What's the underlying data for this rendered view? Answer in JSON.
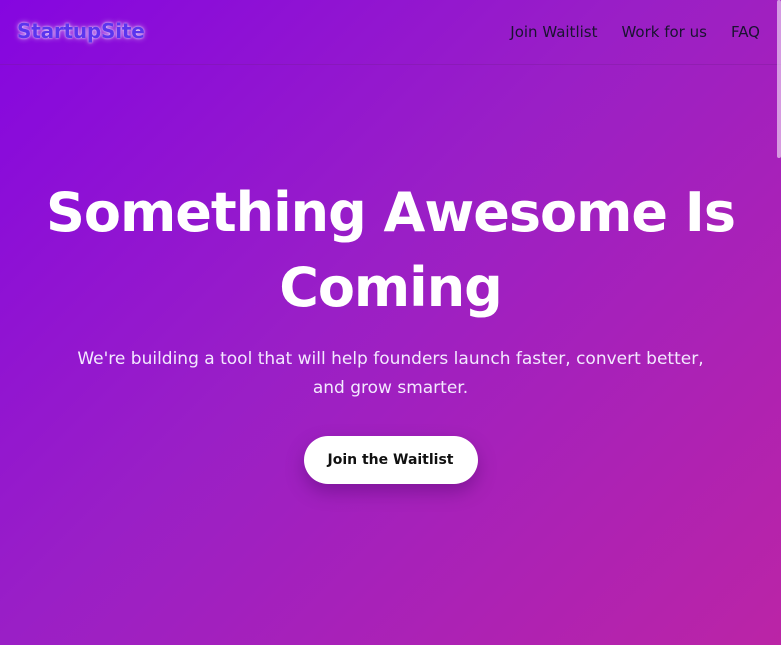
{
  "header": {
    "brand": "StartupSite",
    "nav": [
      "Join Waitlist",
      "Work for us",
      "FAQ"
    ]
  },
  "hero": {
    "title": "Something Awesome Is Coming",
    "subtitle": "We're building a tool that will help founders launch faster, convert better, and grow smarter.",
    "cta_label": "Join the Waitlist"
  },
  "colors": {
    "background_start": "#8506e0",
    "background_end": "#bb24a6",
    "brand": "#5a35ee",
    "nav_text": "#1a1330",
    "cta_background": "#ffffff",
    "cta_text": "#111111"
  }
}
